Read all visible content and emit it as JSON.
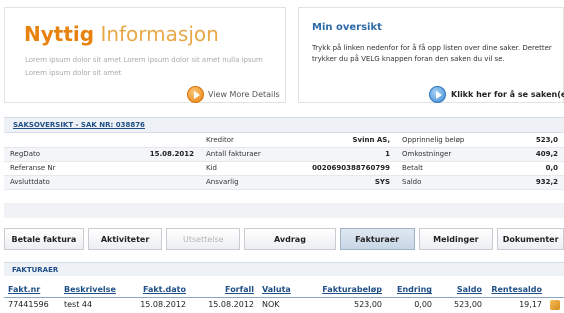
{
  "info": {
    "title_part1": "Nyttig",
    "title_part2": "Informasjon",
    "lorem": "Lorem ipsum dolor sit amet Lorem ipsum dolor sit amet nulla ipsum Lorem ipsum dolor sit amet",
    "view_more": "View More Details"
  },
  "overview": {
    "title": "Min oversikt",
    "text": "Trykk på linken nedenfor for å få opp listen over dine saker. Deretter trykker du på VELG knappen foran den saken du vil se.",
    "link": "Klikk her for å se saken(e)"
  },
  "case": {
    "link": "SAKSOVERSIKT - SAK NR: 038876",
    "rows": [
      {
        "l1": "",
        "v1": "",
        "l2": "Kreditor",
        "v2": "Svinn AS,",
        "l3": "Opprinnelig beløp",
        "v3": "523,0"
      },
      {
        "l1": "RegDato",
        "v1": "15.08.2012",
        "l2": "Antall fakturaer",
        "v2": "1",
        "l3": "Omkostninger",
        "v3": "409,2"
      },
      {
        "l1": "Referanse Nr",
        "v1": "",
        "l2": "Kid",
        "v2": "0020690388760799",
        "l3": "Betalt",
        "v3": "0,0"
      },
      {
        "l1": "Avsluttdato",
        "v1": "",
        "l2": "Ansvarlig",
        "v2": "SYS",
        "l3": "Saldo",
        "v3": "932,2"
      }
    ]
  },
  "tabs": [
    {
      "label": "Betale faktura",
      "state": "normal"
    },
    {
      "label": "Aktiviteter",
      "state": "normal"
    },
    {
      "label": "Utsettelse",
      "state": "disabled"
    },
    {
      "label": "Avdrag",
      "state": "normal"
    },
    {
      "label": "Fakturaer",
      "state": "active"
    },
    {
      "label": "Meldinger",
      "state": "normal"
    },
    {
      "label": "Dokumenter",
      "state": "normal"
    }
  ],
  "invoices": {
    "title": "FAKTURAER",
    "headers": [
      "Fakt.nr",
      "Beskrivelse",
      "Fakt.dato",
      "Forfall",
      "Valuta",
      "Fakturabeløp",
      "Endring",
      "Saldo",
      "Rentesaldo"
    ],
    "rows": [
      [
        "77441596",
        "test 44",
        "15.08.2012",
        "15.08.2012",
        "NOK",
        "523,00",
        "0,00",
        "523,00",
        "19,17"
      ]
    ]
  },
  "colors": {
    "accent_orange": "#e8820e",
    "accent_blue": "#2c6aa8",
    "link_blue": "#1f4f86"
  }
}
